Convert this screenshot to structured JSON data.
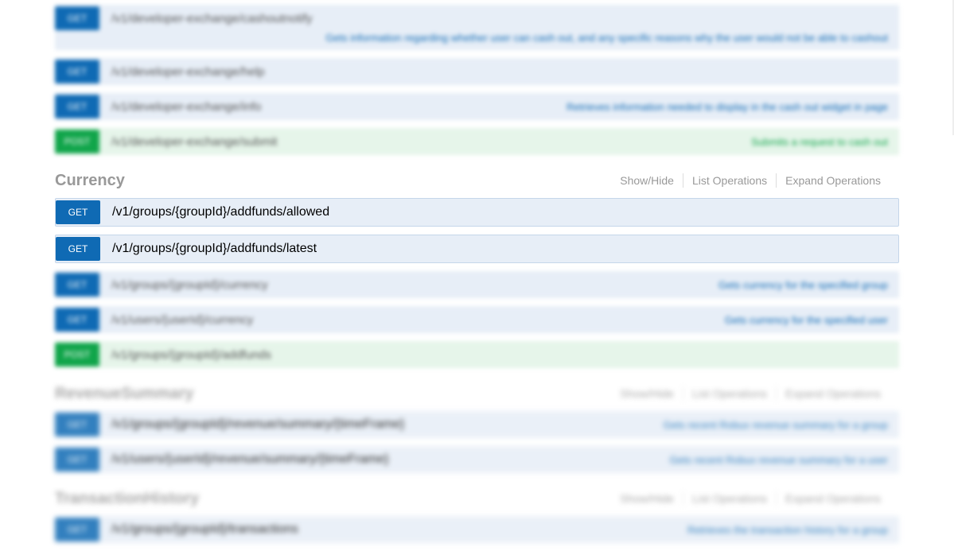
{
  "sections": {
    "developer_exchange": {
      "operations": [
        {
          "method": "GET",
          "path": "/v1/developer-exchange/cashoutnotify",
          "summary": "",
          "description": "Gets information regarding whether user can cash out, and any specific reasons why the user would not be able to cashout"
        },
        {
          "method": "GET",
          "path": "/v1/developer-exchange/help",
          "summary": ""
        },
        {
          "method": "GET",
          "path": "/v1/developer-exchange/info",
          "summary": "Retrieves information needed to display in the cash out widget in page"
        },
        {
          "method": "POST",
          "path": "/v1/developer-exchange/submit",
          "summary": "Submits a request to cash out"
        }
      ]
    },
    "currency": {
      "title": "Currency",
      "links": {
        "show_hide": "Show/Hide",
        "list_operations": "List Operations",
        "expand_operations": "Expand Operations"
      },
      "operations": [
        {
          "method": "GET",
          "path": "/v1/groups/{groupId}/addfunds/allowed",
          "summary": ""
        },
        {
          "method": "GET",
          "path": "/v1/groups/{groupId}/addfunds/latest",
          "summary": ""
        },
        {
          "method": "GET",
          "path": "/v1/groups/{groupId}/currency",
          "summary": "Gets currency for the specified group"
        },
        {
          "method": "GET",
          "path": "/v1/users/{userId}/currency",
          "summary": "Gets currency for the specified user"
        },
        {
          "method": "POST",
          "path": "/v1/groups/{groupId}/addfunds",
          "summary": ""
        }
      ]
    },
    "revenue_summary": {
      "title": "RevenueSummary",
      "links": {
        "show_hide": "Show/Hide",
        "list_operations": "List Operations",
        "expand_operations": "Expand Operations"
      },
      "operations": [
        {
          "method": "GET",
          "path": "/v1/groups/{groupId}/revenue/summary/{timeFrame}",
          "summary": "Gets recent Robux revenue summary for a group"
        },
        {
          "method": "GET",
          "path": "/v1/users/{userId}/revenue/summary/{timeFrame}",
          "summary": "Gets recent Robux revenue summary for a user"
        }
      ]
    },
    "transaction_history": {
      "title": "TransactionHistory",
      "links": {
        "show_hide": "Show/Hide",
        "list_operations": "List Operations",
        "expand_operations": "Expand Operations"
      },
      "operations": [
        {
          "method": "GET",
          "path": "/v1/groups/{groupId}/transactions",
          "summary": "Retrieves the transaction history for a group"
        }
      ]
    }
  },
  "colors": {
    "get": "#0f6ab4",
    "post": "#10a54a",
    "get_bg": "#e7eef7",
    "post_bg": "#e6f5ea"
  }
}
